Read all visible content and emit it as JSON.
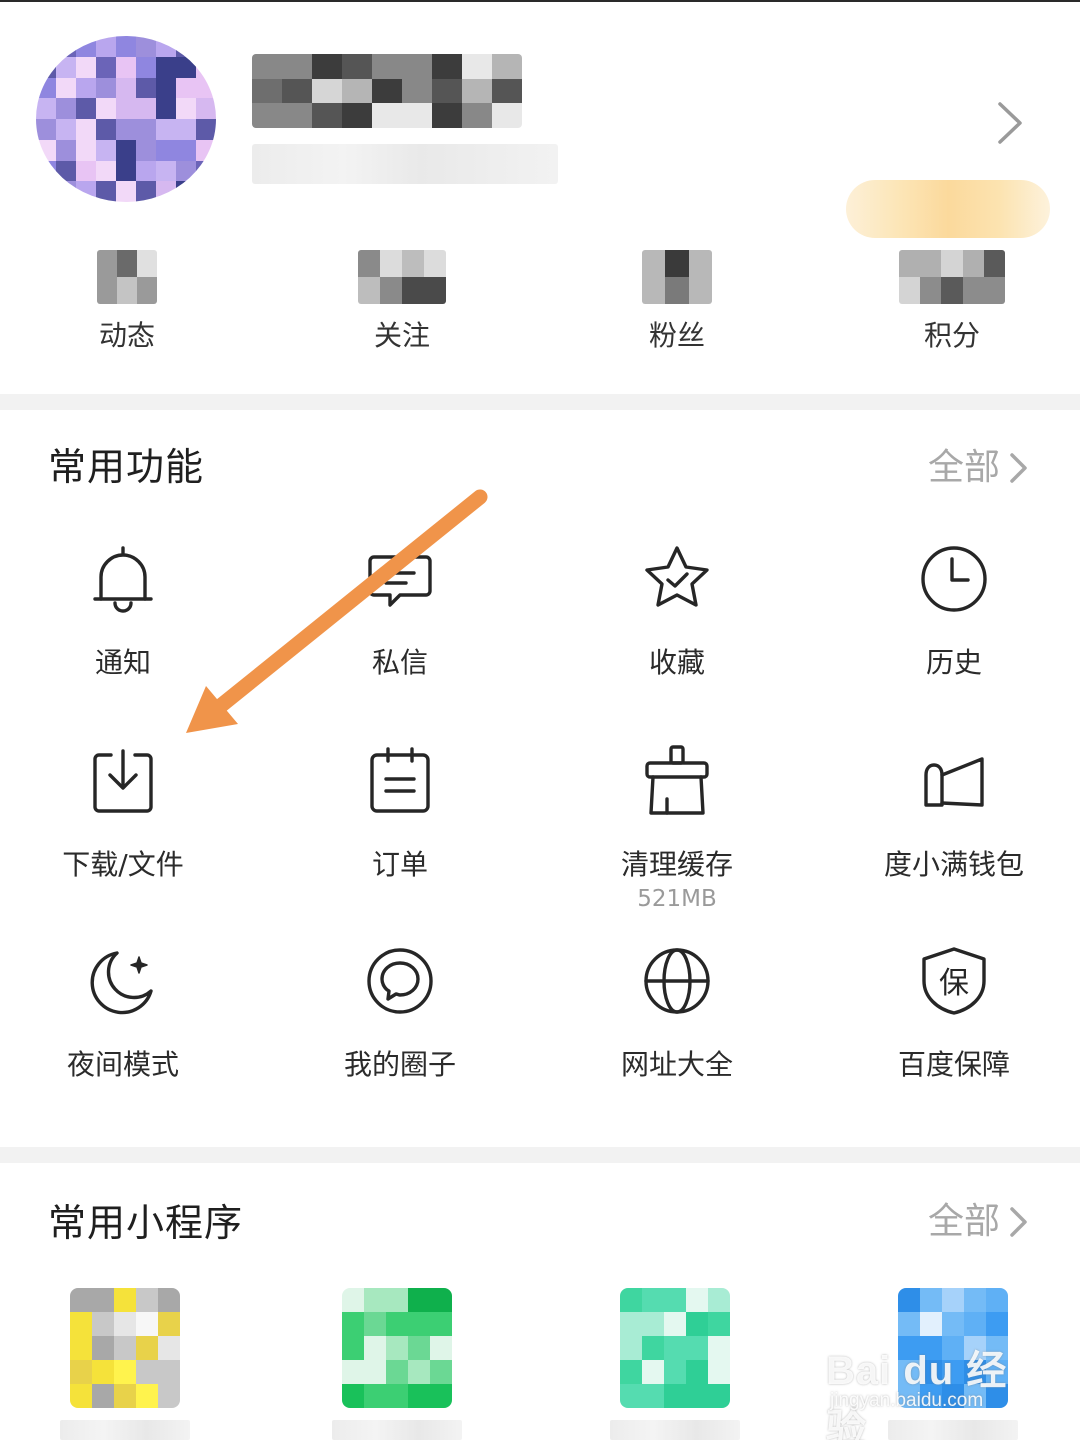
{
  "profile": {
    "stats": [
      {
        "label": "动态"
      },
      {
        "label": "关注"
      },
      {
        "label": "粉丝"
      },
      {
        "label": "积分"
      }
    ]
  },
  "common_functions": {
    "title": "常用功能",
    "all_label": "全部",
    "items": [
      {
        "label": "通知",
        "icon": "bell-icon"
      },
      {
        "label": "私信",
        "icon": "message-icon"
      },
      {
        "label": "收藏",
        "icon": "star-icon"
      },
      {
        "label": "历史",
        "icon": "clock-icon"
      },
      {
        "label": "下载/文件",
        "icon": "download-icon"
      },
      {
        "label": "订单",
        "icon": "order-icon"
      },
      {
        "label": "清理缓存",
        "sub": "521MB",
        "icon": "broom-icon"
      },
      {
        "label": "度小满钱包",
        "icon": "wallet-icon"
      },
      {
        "label": "夜间模式",
        "icon": "moon-icon"
      },
      {
        "label": "我的圈子",
        "icon": "circle-chat-icon"
      },
      {
        "label": "网址大全",
        "icon": "globe-icon"
      },
      {
        "label": "百度保障",
        "icon": "shield-icon",
        "icon_char": "保"
      }
    ]
  },
  "mini_programs": {
    "title": "常用小程序",
    "all_label": "全部"
  },
  "watermark": {
    "logo": "Bai du 经验",
    "url": "jingyan.baidu.com"
  },
  "colors": {
    "arrow": "#f0944a",
    "icon_stroke": "#262626",
    "muted_text": "#a8a8a8",
    "divider": "#f2f2f2"
  }
}
